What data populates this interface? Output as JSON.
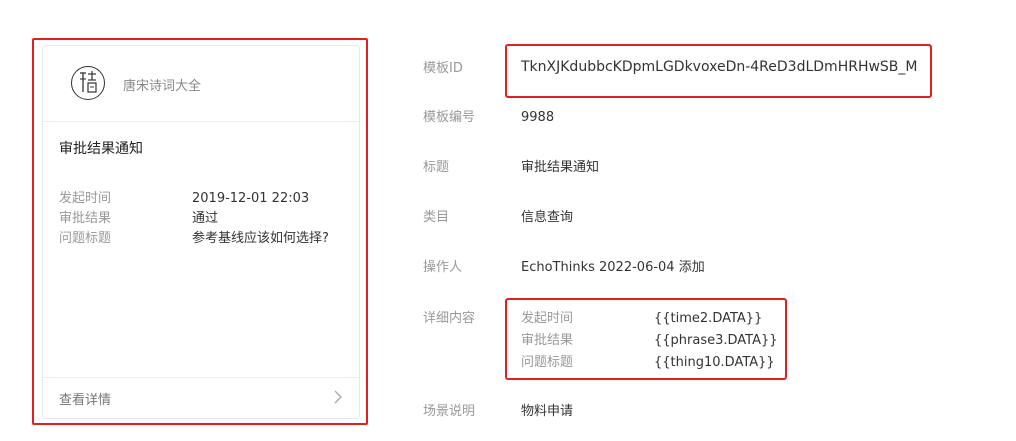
{
  "preview_card": {
    "brand_name": "唐宋诗词大全",
    "logo_glyph": "詩",
    "title": "审批结果通知",
    "fields": [
      {
        "key": "发起时间",
        "value": "2019-12-01 22:03"
      },
      {
        "key": "审批结果",
        "value": "通过"
      },
      {
        "key": "问题标题",
        "value": "参考基线应该如何选择?"
      }
    ],
    "footer_link": "查看详情"
  },
  "details": {
    "template_id": {
      "label": "模板ID",
      "value": "TknXJKdubbcKDpmLGDkvoxeDn-4ReD3dLDmHRHwSB_M"
    },
    "template_no": {
      "label": "模板编号",
      "value": "9988"
    },
    "title": {
      "label": "标题",
      "value": "审批结果通知"
    },
    "category": {
      "label": "类目",
      "value": "信息查询"
    },
    "operator": {
      "label": "操作人",
      "value": "EchoThinks 2022-06-04 添加"
    },
    "content": {
      "label": "详细内容",
      "lines": [
        {
          "key": "发起时间",
          "value": "{{time2.DATA}}"
        },
        {
          "key": "审批结果",
          "value": "{{phrase3.DATA}}"
        },
        {
          "key": "问题标题",
          "value": "{{thing10.DATA}}"
        }
      ]
    },
    "scene": {
      "label": "场景说明",
      "value": "物料申请"
    }
  },
  "colors": {
    "highlight_border": "#e02020",
    "label_gray": "#999999",
    "text_dark": "#333333"
  }
}
